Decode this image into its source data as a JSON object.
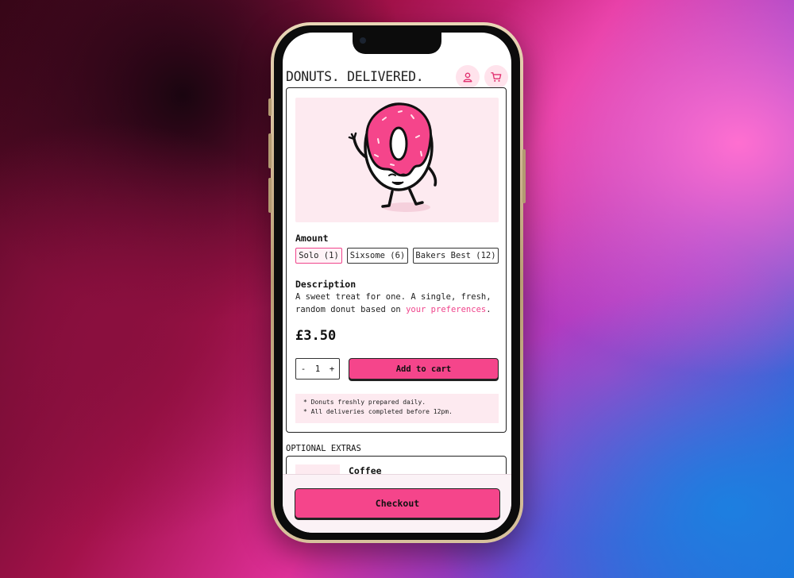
{
  "app": {
    "logo": "DONUTS. DELIVERED.",
    "accent_color": "#f5458b",
    "header_icons": [
      "user-icon",
      "cart-icon"
    ]
  },
  "product": {
    "image": "donut-mascot-illustration",
    "amount_label": "Amount",
    "amount_options": [
      "Solo (1)",
      "Sixsome (6)",
      "Bakers Best (12)"
    ],
    "selected_amount": "Solo (1)",
    "description_label": "Description",
    "description_text": "A sweet treat for one. A single, fresh, random donut based on ",
    "description_link": "your preferences",
    "description_end": ".",
    "price": "£3.50",
    "quantity": "1",
    "minus_label": "-",
    "plus_label": "+",
    "add_to_cart_label": "Add to cart",
    "notes": [
      "* Donuts freshly prepared daily.",
      "* All deliveries completed before 12pm."
    ]
  },
  "extras": {
    "label": "OPTIONAL EXTRAS",
    "items": [
      {
        "title": "Coffee"
      }
    ]
  },
  "footer": {
    "checkout_label": "Checkout"
  }
}
